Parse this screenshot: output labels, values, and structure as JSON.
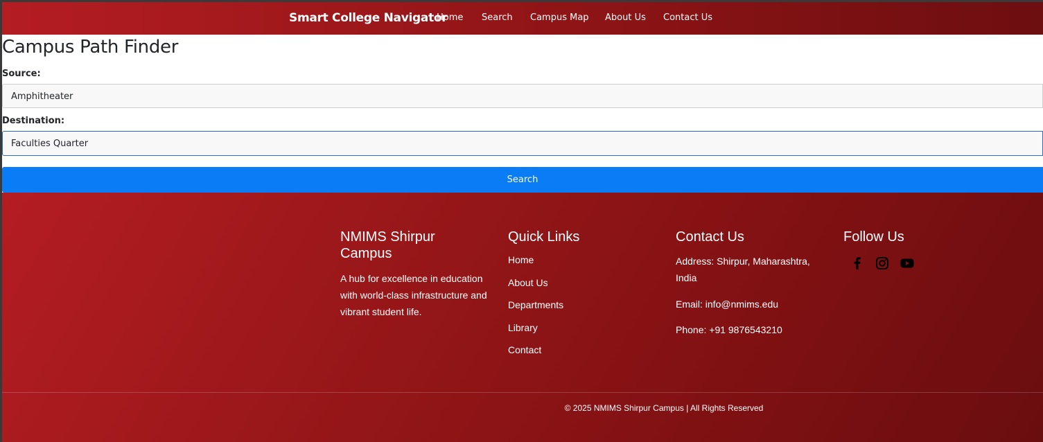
{
  "navbar": {
    "brand": "Smart College Navigator",
    "links": [
      "Home",
      "Search",
      "Campus Map",
      "About Us",
      "Contact Us"
    ]
  },
  "main": {
    "title": "Campus Path Finder",
    "source_label": "Source:",
    "source_value": "Amphitheater",
    "destination_label": "Destination:",
    "destination_value": "Faculties Quarter",
    "search_button": "Search"
  },
  "footer": {
    "about": {
      "heading": "NMIMS Shirpur Campus",
      "text": "A hub for excellence in education with world-class infrastructure and vibrant student life."
    },
    "quick_links": {
      "heading": "Quick Links",
      "items": [
        "Home",
        "About Us",
        "Departments",
        "Library",
        "Contact"
      ]
    },
    "contact": {
      "heading": "Contact Us",
      "address": "Address: Shirpur, Maharashtra, India",
      "email": "Email: info@nmims.edu",
      "phone": "Phone: +91 9876543210"
    },
    "follow": {
      "heading": "Follow Us",
      "icons": [
        "facebook-icon",
        "instagram-icon",
        "youtube-icon"
      ]
    },
    "copyright": "© 2025 NMIMS Shirpur Campus | All Rights Reserved"
  },
  "colors": {
    "brand_red": "#b41d22",
    "dark_red": "#6d0e10",
    "button_blue": "#0a7cf6"
  }
}
